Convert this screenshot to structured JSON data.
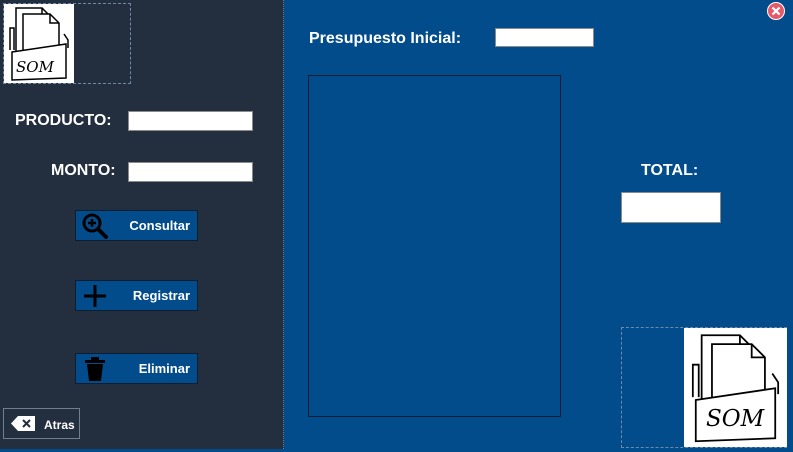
{
  "sidebar": {
    "logo_text": "SOM",
    "producto_label": "PRODUCTO:",
    "producto_value": "",
    "monto_label": "MONTO:",
    "monto_value": "",
    "buttons": {
      "consultar": "Consultar",
      "registrar": "Registrar",
      "eliminar": "Eliminar"
    },
    "back_label": "Atras"
  },
  "main": {
    "presupuesto_label": "Presupuesto Inicial:",
    "presupuesto_value": "",
    "total_label": "TOTAL:",
    "total_value": "",
    "logo_text": "SOM"
  },
  "colors": {
    "main_bg": "#034c8c",
    "sidebar_bg": "#232e3e",
    "close": "#e55a6a"
  }
}
